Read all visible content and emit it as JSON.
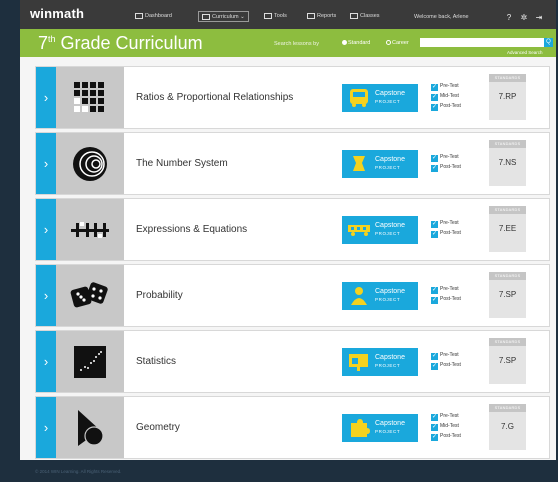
{
  "nav": {
    "brand": "winmath",
    "items": [
      {
        "label": "Dashboard",
        "icon": "dashboard-icon"
      },
      {
        "label": "Curriculum",
        "icon": "curriculum-icon",
        "active": true
      },
      {
        "label": "Tools",
        "icon": "tools-icon"
      },
      {
        "label": "Reports",
        "icon": "reports-icon"
      },
      {
        "label": "Classes",
        "icon": "classes-icon"
      }
    ],
    "welcome": "Welcome back, Arlene",
    "icons": [
      "help-icon",
      "gear-icon",
      "logout-icon"
    ]
  },
  "header": {
    "title_grade": "7",
    "title_sup": "th",
    "title_rest": " Grade Curriculum",
    "search_label": "Search lessons by",
    "radio_standard": "Standard",
    "radio_career": "Career",
    "search_placeholder": "",
    "search_button": "Q",
    "advanced_search": "Advanced Search"
  },
  "colors": {
    "accent_blue": "#1aa8dc",
    "header_green": "#8dbd3f",
    "top_nav": "#3a3a3a",
    "footer_navy": "#1e2f3e"
  },
  "lessons": [
    {
      "name": "Ratios & Proportional Relationships",
      "icon": "grid-squares-icon",
      "capstone_icon": "bus-icon",
      "capstone": "Capstone",
      "project": "PROJECT",
      "tests": [
        "Pre-Test",
        "Mid-Test",
        "Post-Test"
      ],
      "standards_label": "STANDARDS",
      "standard": "7.RP"
    },
    {
      "name": "The Number System",
      "icon": "concentric-circles-icon",
      "capstone_icon": "trophy-icon",
      "capstone": "Capstone",
      "project": "PROJECT",
      "tests": [
        "Pre-Test",
        "Post-Test"
      ],
      "standards_label": "STANDARDS",
      "standard": "7.NS"
    },
    {
      "name": "Expressions & Equations",
      "icon": "operators-icon",
      "capstone_icon": "truck-icon",
      "capstone": "Capstone",
      "project": "PROJECT",
      "tests": [
        "Pre-Test",
        "Post-Test"
      ],
      "standards_label": "STANDARDS",
      "standard": "7.EE"
    },
    {
      "name": "Probability",
      "icon": "dice-icon",
      "capstone_icon": "person-icon",
      "capstone": "Capstone",
      "project": "PROJECT",
      "tests": [
        "Pre-Test",
        "Post-Test"
      ],
      "standards_label": "STANDARDS",
      "standard": "7.SP"
    },
    {
      "name": "Statistics",
      "icon": "scatter-plot-icon",
      "capstone_icon": "presentation-icon",
      "capstone": "Capstone",
      "project": "PROJECT",
      "tests": [
        "Pre-Test",
        "Post-Test"
      ],
      "standards_label": "STANDARDS",
      "standard": "7.SP"
    },
    {
      "name": "Geometry",
      "icon": "shapes-icon",
      "capstone_icon": "puzzle-icon",
      "capstone": "Capstone",
      "project": "PROJECT",
      "tests": [
        "Pre-Test",
        "Mid-Test",
        "Post-Test"
      ],
      "standards_label": "STANDARDS",
      "standard": "7.G"
    }
  ],
  "footer": {
    "copyright": "© 2014 WIN Learning. All Rights Reserved."
  }
}
